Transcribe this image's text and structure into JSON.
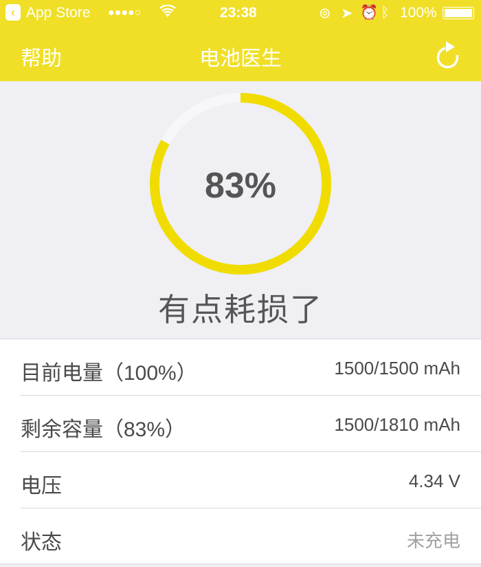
{
  "status_bar": {
    "back_app": "App Store",
    "signal": "●●●●○",
    "time": "23:38",
    "battery": "100%"
  },
  "nav": {
    "left": "帮助",
    "title": "电池医生",
    "right_icon": "refresh-icon"
  },
  "gauge": {
    "percent_label": "83%",
    "percent_value": 83,
    "verdict": "有点耗损了",
    "color": "#f0dc00",
    "track_color": "#f7f7f9"
  },
  "rows": [
    {
      "label": "目前电量（100%）",
      "value": "1500/1500 mAh"
    },
    {
      "label": "剩余容量（83%）",
      "value": "1500/1810 mAh"
    },
    {
      "label": "电压",
      "value": "4.34 V"
    },
    {
      "label": "状态",
      "value": "未充电"
    }
  ]
}
